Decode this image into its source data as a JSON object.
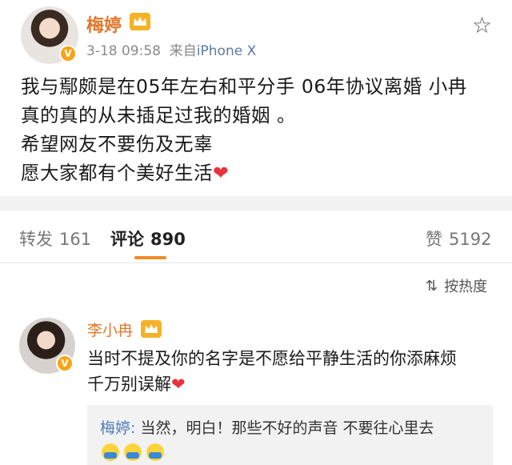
{
  "post": {
    "author": "梅婷",
    "verified_mark": "V",
    "date": "3-18 09:58",
    "source_prefix": "来自",
    "device": "iPhone X",
    "star_icon": "☆",
    "lines": [
      "我与鄢颇是在05年左右和平分手  06年协议离婚 小冉",
      "真的真的从未插足过我的婚姻 。",
      "希望网友不要伤及无辜",
      "愿大家都有个美好生活"
    ],
    "heart": "❤"
  },
  "tabs": {
    "repost_label": "转发",
    "repost_count": "161",
    "comment_label": "评论",
    "comment_count": "890",
    "like_label": "赞",
    "like_count": "5192"
  },
  "sort": {
    "icon": "⇅",
    "label": "按热度"
  },
  "comment": {
    "author": "李小冉",
    "verified_mark": "V",
    "lines": [
      "当时不提及你的名字是不愿给平静生活的你添麻烦",
      "千万别误解"
    ],
    "heart": "❤",
    "reply": {
      "author": "梅婷:",
      "text": "当然，明白！那些不好的声音 不要往心里去"
    }
  }
}
